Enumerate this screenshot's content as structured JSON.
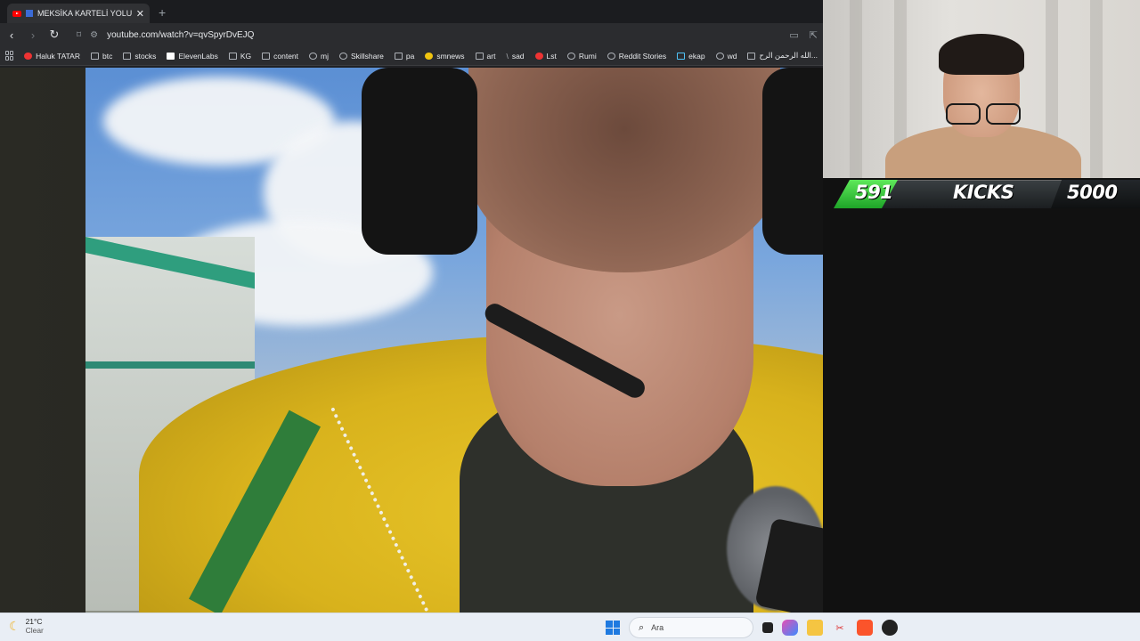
{
  "browser": {
    "tab": {
      "title": "MEKSİKA KARTELİ YOLUMUZU",
      "close": "✕"
    },
    "new_tab": "+",
    "address": {
      "url": "youtube.com/watch?v=qvSpyrDvEJQ"
    },
    "nav": {
      "back": "‹",
      "forward": "›",
      "reload": "↻",
      "bookmark": "⌑"
    },
    "bookmarks": [
      {
        "label": "Haluk TATAR",
        "icon": "youtube-icon"
      },
      {
        "label": "btc",
        "icon": "folder-icon"
      },
      {
        "label": "stocks",
        "icon": "folder-icon"
      },
      {
        "label": "ElevenLabs",
        "icon": "elevenlabs-icon"
      },
      {
        "label": "KG",
        "icon": "folder-icon"
      },
      {
        "label": "content",
        "icon": "folder-icon"
      },
      {
        "label": "mj",
        "icon": "github-icon"
      },
      {
        "label": "Skillshare",
        "icon": "skillshare-icon"
      },
      {
        "label": "pa",
        "icon": "folder-icon"
      },
      {
        "label": "smnews",
        "icon": "smiley-icon"
      },
      {
        "label": "art",
        "icon": "folder-icon"
      },
      {
        "label": "sad",
        "icon": "slash-icon"
      },
      {
        "label": "Lst",
        "icon": "s-logo-icon"
      },
      {
        "label": "Rumi",
        "icon": "globe-icon"
      },
      {
        "label": "Reddit Stories",
        "icon": "d-logo-icon"
      },
      {
        "label": "ekap",
        "icon": "ekap-icon"
      },
      {
        "label": "wd",
        "icon": "globe-icon"
      },
      {
        "label": "الله الرحمن الرح...",
        "icon": "page-icon"
      }
    ]
  },
  "overlay": {
    "scoreboard": {
      "current": "591",
      "label": "KICKS",
      "goal": "5000"
    },
    "colors": {
      "accent_green": "#2fb52f",
      "dark": "#1b1e20"
    }
  },
  "taskbar": {
    "weather": {
      "temp": "21°C",
      "condition": "Clear"
    },
    "search_placeholder": "Ara"
  }
}
